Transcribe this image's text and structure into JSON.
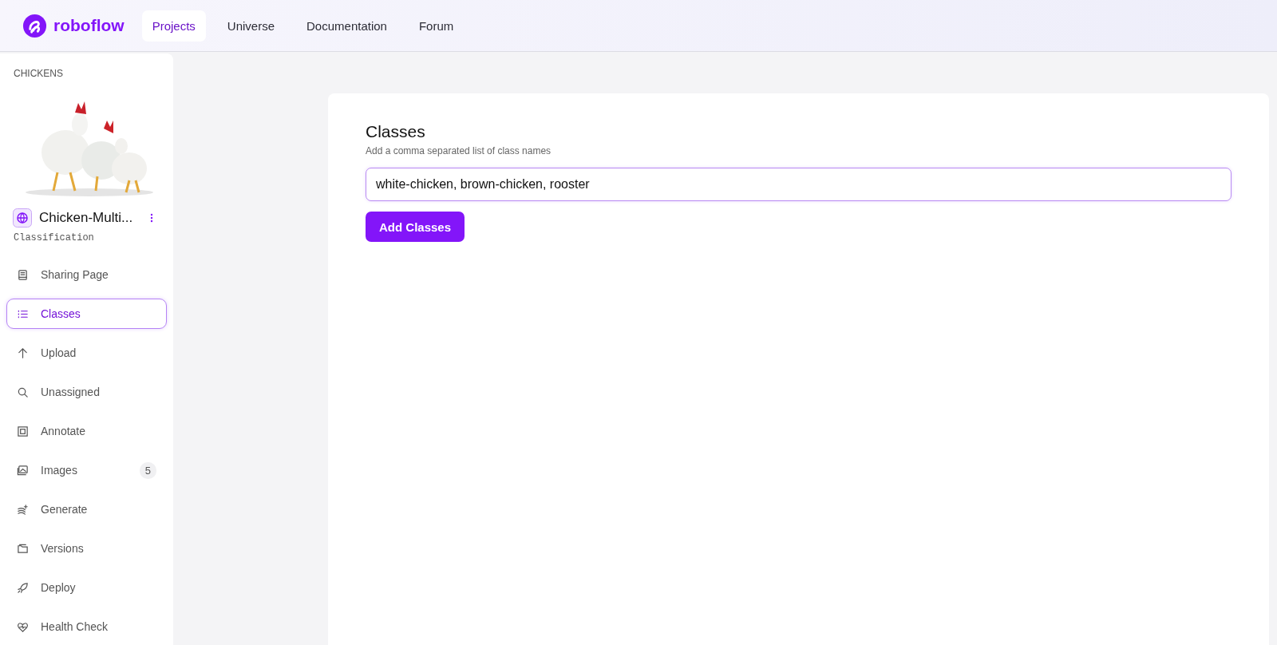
{
  "header": {
    "logo": "roboflow",
    "nav": [
      {
        "label": "Projects",
        "selected": true
      },
      {
        "label": "Universe",
        "selected": false
      },
      {
        "label": "Documentation",
        "selected": false
      },
      {
        "label": "Forum",
        "selected": false
      }
    ]
  },
  "sidebar": {
    "workspace": "CHICKENS",
    "project": {
      "kind": "picture",
      "name": "Chicken-Multi...",
      "type": "Classification"
    },
    "items": [
      {
        "label": "Sharing Page",
        "selected": false
      },
      {
        "label": "Classes",
        "selected": true
      },
      {
        "label": "Upload",
        "selected": false
      },
      {
        "label": "Unassigned",
        "selected": false
      },
      {
        "label": "Annotate",
        "selected": false
      },
      {
        "label": "Images",
        "selected": false,
        "count": "5"
      },
      {
        "label": "Generate",
        "selected": false
      },
      {
        "label": "Versions",
        "selected": false
      },
      {
        "label": "Deploy",
        "selected": false
      },
      {
        "label": "Health Check",
        "selected": false
      }
    ]
  },
  "main": {
    "title": "Classes",
    "subtitle": "Add a comma separated list of class names",
    "input": {
      "value": "white-chicken, brown-chicken, rooster"
    },
    "button": "Add Classes"
  }
}
